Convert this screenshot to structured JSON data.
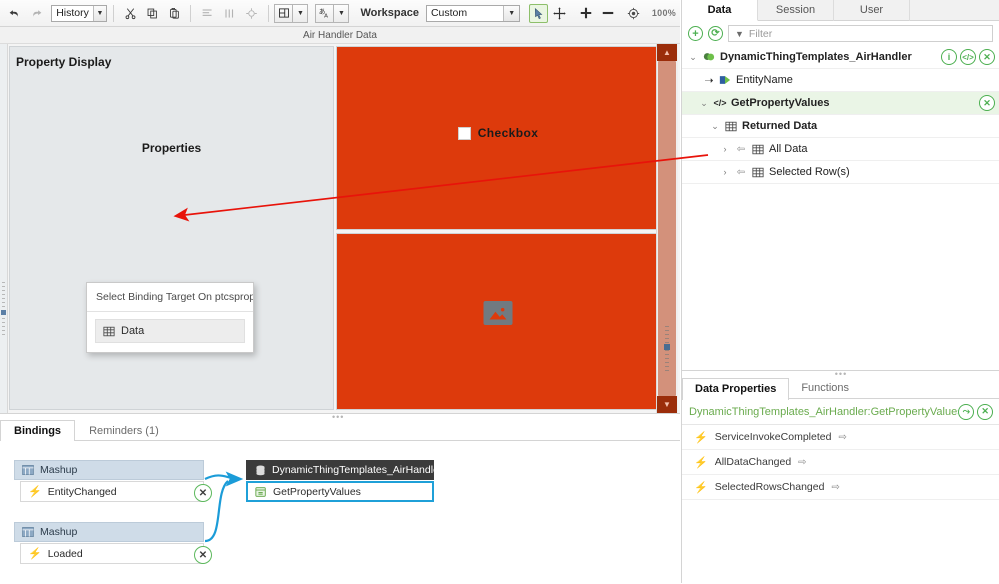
{
  "toolbar": {
    "undo_icon": "undo-arrow-icon",
    "redo_icon": "redo-arrow-icon",
    "history_label": "History",
    "cut_icon": "scissors-icon",
    "copy_icon": "copy-icon",
    "paste_icon": "paste-icon",
    "align_icon": "align-icon",
    "distribute_icon": "distribute-icon",
    "target_icon": "target-icon",
    "layout_icon": "layout-icon",
    "font_icon": "font-icon",
    "workspace_label": "Workspace",
    "workspace_value": "Custom",
    "select_tool_icon": "cursor-arrow-icon",
    "pan_tool_icon": "move-cross-icon",
    "zoom_in_icon": "plus-icon",
    "zoom_out_icon": "minus-icon",
    "zoom_fit_icon": "target-circle-icon",
    "zoom_value": "100%"
  },
  "canvas": {
    "title": "Air Handler Data",
    "property_display_title": "Property Display",
    "properties_label": "Properties",
    "checkbox_label": "Checkbox",
    "image_placeholder_icon": "image-placeholder-icon",
    "orange_color": "#dd3a0c",
    "scroll_up_icon": "chevron-up-icon",
    "scroll_down_icon": "chevron-down-icon"
  },
  "popup": {
    "title": "Select Binding Target On ptcsprop...",
    "items": [
      {
        "label": "Data",
        "icon": "table-grid-icon"
      }
    ]
  },
  "bindings_panel": {
    "tabs": [
      {
        "label": "Bindings",
        "active": true
      },
      {
        "label": "Reminders (1)",
        "active": false
      }
    ],
    "sources": [
      {
        "group": "Mashup",
        "group_icon": "mashup-icon",
        "event": "EntityChanged",
        "event_icon": "bolt-icon",
        "remove_icon": "remove-binding-icon"
      },
      {
        "group": "Mashup",
        "group_icon": "mashup-icon",
        "event": "Loaded",
        "event_icon": "bolt-icon",
        "remove_icon": "remove-binding-icon"
      }
    ],
    "target": {
      "header": "DynamicThingTemplates_AirHandler",
      "header_icon": "database-icon",
      "service": "GetPropertyValues",
      "service_icon": "service-icon"
    }
  },
  "right_panel": {
    "tabs": [
      {
        "label": "Data",
        "active": true
      },
      {
        "label": "Session",
        "active": false
      },
      {
        "label": "User",
        "active": false
      }
    ],
    "add_icon": "plus-circle-icon",
    "refresh_icon": "refresh-circle-icon",
    "filter_icon": "funnel-icon",
    "filter_placeholder": "Filter",
    "tree": [
      {
        "label": "DynamicThingTemplates_AirHandler",
        "icon": "entity-icon",
        "caret": "expanded",
        "indent": 0,
        "bold": true,
        "highlight": false,
        "actions": [
          "info-icon",
          "code-icon",
          "close-icon"
        ]
      },
      {
        "label": "EntityName",
        "icon": "parameter-icon",
        "caret": "arrow-right",
        "indent": 1,
        "bold": false,
        "highlight": false,
        "actions": []
      },
      {
        "label": "GetPropertyValues",
        "icon": "code-tag-icon",
        "caret": "expanded",
        "indent": 1,
        "bold": true,
        "highlight": true,
        "actions": [
          "close-icon"
        ]
      },
      {
        "label": "Returned Data",
        "icon": "table-grid-icon",
        "caret": "expanded",
        "indent": 2,
        "bold": true,
        "highlight": false,
        "actions": []
      },
      {
        "label": "All Data",
        "icon": "table-grid-icon",
        "caret": "collapsed",
        "indent": 3,
        "bold": false,
        "highlight": false,
        "bind_icon": "bind-arrow-icon",
        "actions": []
      },
      {
        "label": "Selected Row(s)",
        "icon": "table-grid-icon",
        "caret": "collapsed",
        "indent": 3,
        "bold": false,
        "highlight": false,
        "bind_icon": "bind-arrow-icon",
        "actions": []
      }
    ]
  },
  "data_properties": {
    "tabs": [
      {
        "label": "Data Properties",
        "active": true
      },
      {
        "label": "Functions",
        "active": false
      }
    ],
    "selected_service": "DynamicThingTemplates_AirHandler:GetPropertyValues",
    "share_icon": "share-icon",
    "close_icon": "close-icon",
    "events": [
      {
        "label": "ServiceInvokeCompleted",
        "icon": "bolt-icon",
        "bind_icon": "bind-arrow-icon"
      },
      {
        "label": "AllDataChanged",
        "icon": "bolt-icon",
        "bind_icon": "bind-arrow-icon"
      },
      {
        "label": "SelectedRowsChanged",
        "icon": "bolt-icon",
        "bind_icon": "bind-arrow-icon"
      }
    ]
  },
  "annotation": {
    "arrow_color": "#e8130a",
    "description": "red-pointer-arrow"
  }
}
